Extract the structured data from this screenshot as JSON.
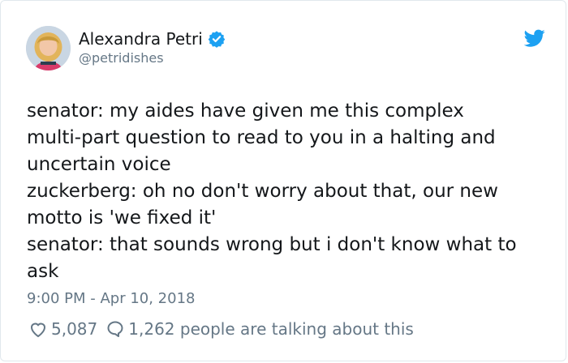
{
  "author": {
    "name": "Alexandra Petri",
    "handle": "@petridishes",
    "avatar_icon": "profile-photo",
    "verified_icon": "verified-badge-icon"
  },
  "tweet": {
    "lines": [
      "senator: my aides have given me this complex",
      "multi-part question to read to you in a halting and",
      "uncertain voice",
      "zuckerberg: oh no don't worry about that, our new",
      "motto is 'we fixed it'",
      "senator: that sounds wrong but i don't know what to",
      "ask"
    ],
    "timestamp": "9:00 PM - Apr 10, 2018"
  },
  "engagement": {
    "likes": "5,087",
    "comments_text": "1,262 people are talking about this"
  },
  "colors": {
    "brand_blue": "#1da1f2",
    "text": "#14171a",
    "muted": "#657786"
  }
}
